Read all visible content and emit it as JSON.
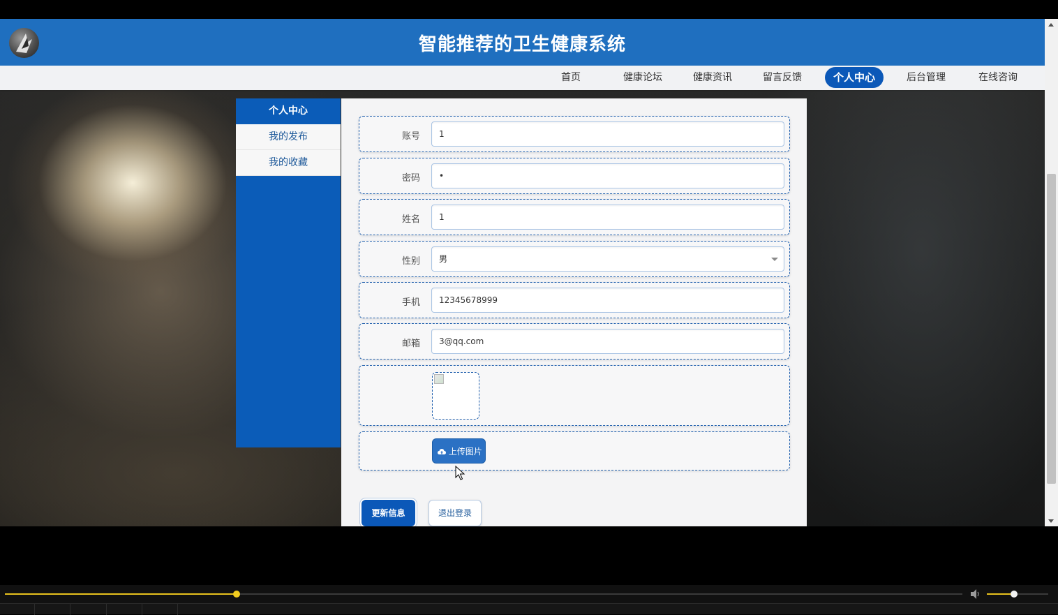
{
  "header": {
    "title": "智能推荐的卫生健康系统"
  },
  "nav": {
    "items": [
      {
        "label": "首页"
      },
      {
        "label": "健康论坛"
      },
      {
        "label": "健康资讯"
      },
      {
        "label": "留言反馈"
      },
      {
        "label": "个人中心",
        "active": true
      },
      {
        "label": "后台管理"
      },
      {
        "label": "在线咨询"
      }
    ]
  },
  "sidebar": {
    "items": [
      {
        "label": "个人中心",
        "active": true
      },
      {
        "label": "我的发布"
      },
      {
        "label": "我的收藏"
      }
    ]
  },
  "form": {
    "account": {
      "label": "账号",
      "value": "1"
    },
    "password": {
      "label": "密码",
      "value": "•"
    },
    "name": {
      "label": "姓名",
      "value": "1"
    },
    "gender": {
      "label": "性别",
      "value": "男"
    },
    "phone": {
      "label": "手机",
      "value": "12345678999"
    },
    "email": {
      "label": "邮箱",
      "value": "3@qq.com"
    },
    "upload_label": "上传图片",
    "upload_icon": "cloud-upload-icon"
  },
  "actions": {
    "update": "更新信息",
    "logout": "退出登录"
  },
  "player": {
    "progress": 0.242,
    "volume": 0.44
  },
  "colors": {
    "primary": "#0b58b8",
    "header": "#1f6fbf",
    "progress": "#e8c21e"
  }
}
